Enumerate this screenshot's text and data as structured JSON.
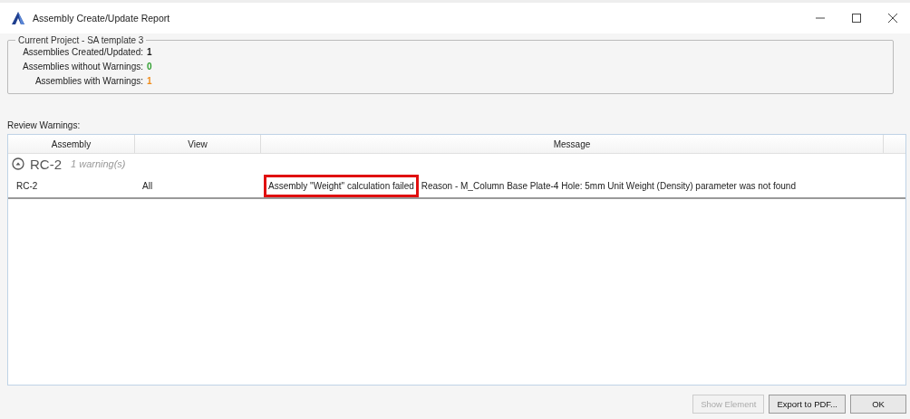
{
  "window": {
    "title": "Assembly Create/Update Report"
  },
  "project": {
    "legend": "Current Project - SA template 3",
    "stats": [
      {
        "label": "Assemblies Created/Updated:",
        "value": "1",
        "color": "#1a1a1a"
      },
      {
        "label": "Assemblies without Warnings:",
        "value": "0",
        "color": "#2e9e2e"
      },
      {
        "label": "Assemblies with Warnings:",
        "value": "1",
        "color": "#f08c1a"
      }
    ]
  },
  "review": {
    "label": "Review Warnings:",
    "columns": [
      "Assembly",
      "View",
      "Message"
    ],
    "groups": [
      {
        "name": "RC-2",
        "count": "1 warning(s)",
        "expanded": true,
        "rows": [
          {
            "assembly": "RC-2",
            "view": "All",
            "message": [
              {
                "text": "Assembly \"Weight\" calculation failed",
                "highlighted": true
              },
              {
                "text": " Reason - M_Column Base Plate-4 Hole: 5mm Unit Weight (Density) parameter was not found",
                "highlighted": false
              }
            ]
          }
        ]
      }
    ]
  },
  "buttons": [
    {
      "label": "Show Element",
      "disabled": true
    },
    {
      "label": "Export to PDF...",
      "disabled": false
    },
    {
      "label": "OK",
      "disabled": false
    }
  ]
}
